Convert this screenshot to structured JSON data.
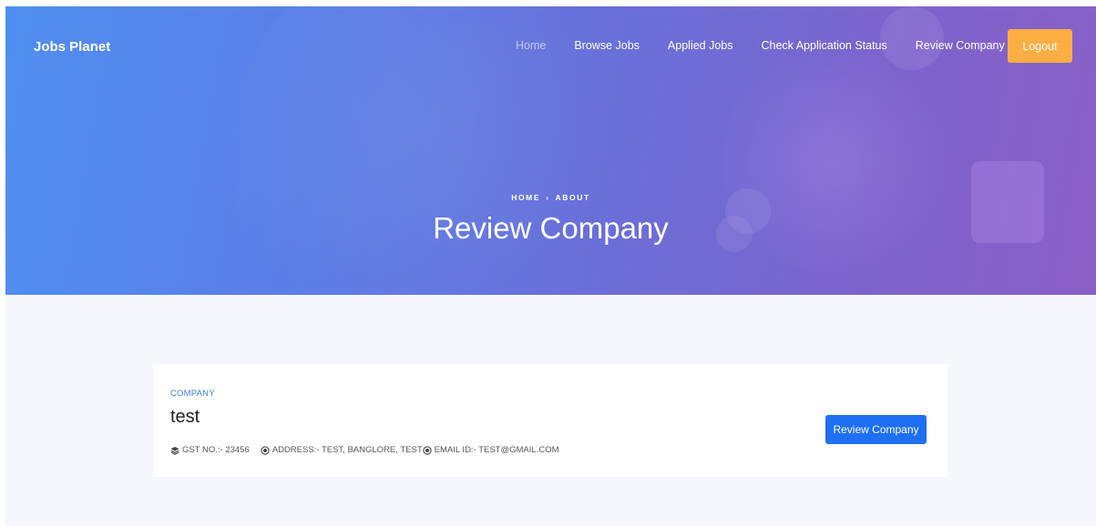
{
  "nav": {
    "brand": "Jobs Planet",
    "items": [
      {
        "label": "Home",
        "active": true
      },
      {
        "label": "Browse Jobs",
        "active": false
      },
      {
        "label": "Applied Jobs",
        "active": false
      },
      {
        "label": "Check Application Status",
        "active": false
      },
      {
        "label": "Review Company",
        "active": false
      }
    ],
    "logout_label": "Logout"
  },
  "hero": {
    "breadcrumb": [
      "HOME",
      "ABOUT"
    ],
    "breadcrumb_sep": "›",
    "title": "Review Company"
  },
  "company_card": {
    "category": "COMPANY",
    "name": "test",
    "gst": "GST NO.:- 23456",
    "address": "ADDRESS:- TEST, BANGLORE, TEST",
    "email": "EMAIL ID:- TEST@GMAIL.COM",
    "action_label": "Review Company"
  },
  "colors": {
    "logout": "#fcae43",
    "primary_button": "#1e6ff2",
    "category_text": "#3b7ddd",
    "content_bg": "#f6f7fa"
  },
  "icons": {
    "gst": "layers-icon",
    "address": "target-icon",
    "email": "target-icon"
  }
}
